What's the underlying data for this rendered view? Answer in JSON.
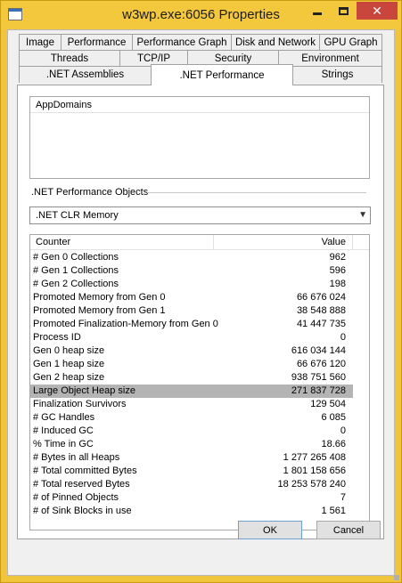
{
  "window": {
    "title": "w3wp.exe:6056 Properties"
  },
  "tabs_row1": [
    "Image",
    "Performance",
    "Performance Graph",
    "Disk and Network",
    "GPU Graph"
  ],
  "tabs_row2": [
    "Threads",
    "TCP/IP",
    "Security",
    "Environment"
  ],
  "tabs_row3": [
    ".NET Assemblies",
    ".NET Performance",
    "Strings"
  ],
  "active_tab": ".NET Performance",
  "appdomains": {
    "header": "AppDomains"
  },
  "perf_objects": {
    "label": ".NET Performance Objects",
    "selected": ".NET CLR Memory"
  },
  "counters": {
    "col_counter": "Counter",
    "col_value": "Value",
    "rows": [
      {
        "name": "# Gen 0 Collections",
        "value": "962"
      },
      {
        "name": "# Gen 1 Collections",
        "value": "596"
      },
      {
        "name": "# Gen 2 Collections",
        "value": "198"
      },
      {
        "name": "Promoted Memory from Gen 0",
        "value": "66 676 024"
      },
      {
        "name": "Promoted Memory from Gen 1",
        "value": "38 548 888"
      },
      {
        "name": "Promoted Finalization-Memory from Gen 0",
        "value": "41 447 735"
      },
      {
        "name": "Process ID",
        "value": "0"
      },
      {
        "name": "Gen 0 heap size",
        "value": "616 034 144"
      },
      {
        "name": "Gen 1 heap size",
        "value": "66 676 120"
      },
      {
        "name": "Gen 2 heap size",
        "value": "938 751 560"
      },
      {
        "name": "Large Object Heap size",
        "value": "271 837 728",
        "selected": true
      },
      {
        "name": "Finalization Survivors",
        "value": "129 504"
      },
      {
        "name": "# GC Handles",
        "value": "6 085"
      },
      {
        "name": "# Induced GC",
        "value": "0"
      },
      {
        "name": "% Time in GC",
        "value": "18.66"
      },
      {
        "name": "# Bytes in all Heaps",
        "value": "1 277 265 408"
      },
      {
        "name": "# Total committed Bytes",
        "value": "1 801 158 656"
      },
      {
        "name": "# Total reserved Bytes",
        "value": "18 253 578 240"
      },
      {
        "name": "# of Pinned Objects",
        "value": "7"
      },
      {
        "name": "# of Sink Blocks in use",
        "value": "1 561"
      }
    ]
  },
  "buttons": {
    "ok": "OK",
    "cancel": "Cancel"
  },
  "icons": {
    "app": "app-window-icon",
    "minimize": "minimize-icon",
    "maximize": "maximize-icon",
    "close": "close-icon",
    "dropdown": "chevron-down-icon"
  },
  "colors": {
    "titlebar": "#f4c83c",
    "close_button": "#c9463d",
    "selection": "#b4b4b4"
  }
}
